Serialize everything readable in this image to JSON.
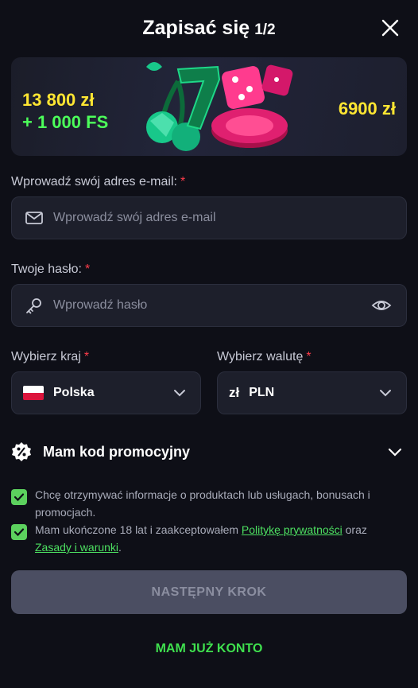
{
  "header": {
    "title": "Zapisać się",
    "step": "1/2"
  },
  "banner": {
    "left_amount": "13 800 zł",
    "left_fs": "+ 1 000 FS",
    "right_amount": "6900 zł",
    "colors": {
      "amount": "#ffe632",
      "fs": "#4cff5a"
    }
  },
  "email": {
    "label": "Wprowadź swój adres e-mail:",
    "required": "*",
    "placeholder": "Wprowadź swój adres e-mail",
    "icon": "envelope-icon"
  },
  "password": {
    "label": "Twoje hasło:",
    "required": "*",
    "placeholder": "Wprowadź hasło",
    "icon": "key-icon",
    "toggle_icon": "eye-icon"
  },
  "country": {
    "label": "Wybierz kraj",
    "required": "*",
    "value": "Polska",
    "icon": "poland-flag-icon"
  },
  "currency": {
    "label": "Wybierz walutę",
    "required": "*",
    "symbol": "zł",
    "value": "PLN"
  },
  "promo": {
    "label": "Mam kod promocyjny",
    "icon": "percent-badge-icon"
  },
  "consents": {
    "marketing": "Chcę otrzymywać informacje o produktach lub usługach, bonusach i promocjach.",
    "age_prefix": "Mam ukończone 18 lat i zaakceptowałem ",
    "privacy_link": "Politykę prywatności",
    "age_middle": " oraz ",
    "terms_link": "Zasady i warunki",
    "age_suffix": "."
  },
  "buttons": {
    "next": "NASTĘPNY KROK",
    "login": "MAM JUŻ KONTO"
  },
  "theme": {
    "accent": "#3fe04e",
    "required": "#ff3d4b",
    "background": "#0e0f17"
  }
}
